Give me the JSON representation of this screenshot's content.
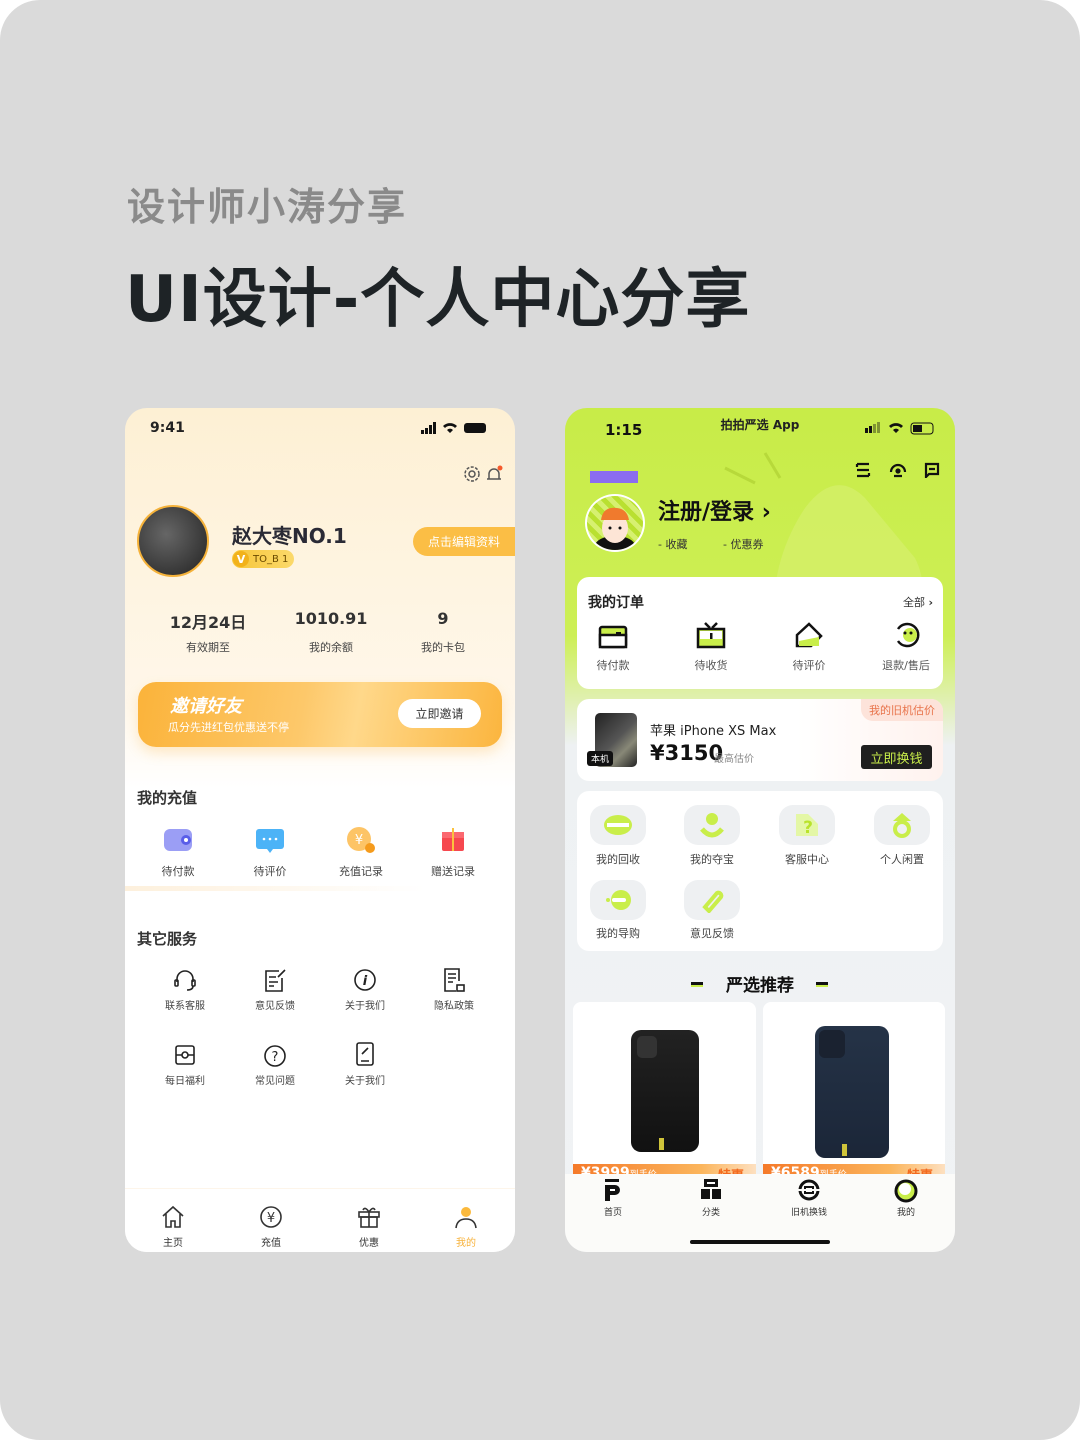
{
  "header": {
    "subtitle": "设计师小涛分享",
    "title": "UI设计-个人中心分享"
  },
  "colors": {
    "orange": "#fbb93c",
    "green": "#c9ee4a",
    "purple": "#8b6cf0",
    "dark": "#1f1f1f"
  },
  "left_phone": {
    "status_time": "9:41",
    "username": "赵大枣NO.1",
    "badge": {
      "icon": "V",
      "label": "TO_B 1"
    },
    "edit_button": "点击编辑资料",
    "stats": [
      {
        "value": "12月24日",
        "label": "有效期至"
      },
      {
        "value": "1010.91",
        "label": "我的余额"
      },
      {
        "value": "9",
        "label": "我的卡包"
      }
    ],
    "invite": {
      "title": "邀请好友",
      "subtitle": "瓜分先进红包优惠送不停",
      "button": "立即邀请"
    },
    "recharge": {
      "title": "我的充值",
      "items": [
        {
          "label": "待付款",
          "icon": "wallet-icon"
        },
        {
          "label": "待评价",
          "icon": "chat-icon"
        },
        {
          "label": "充值记录",
          "icon": "yuan-coin-icon"
        },
        {
          "label": "赠送记录",
          "icon": "gift-icon"
        }
      ]
    },
    "services": {
      "title": "其它服务",
      "items": [
        {
          "label": "联系客服",
          "icon": "headset-icon"
        },
        {
          "label": "意见反馈",
          "icon": "feedback-icon"
        },
        {
          "label": "关于我们",
          "icon": "info-icon"
        },
        {
          "label": "隐私政策",
          "icon": "privacy-icon"
        },
        {
          "label": "每日福利",
          "icon": "welfare-icon"
        },
        {
          "label": "常见问题",
          "icon": "question-icon"
        },
        {
          "label": "关于我们",
          "icon": "phone-link-icon"
        }
      ]
    },
    "tabs": [
      {
        "label": "主页",
        "icon": "home-icon"
      },
      {
        "label": "充值",
        "icon": "recharge-icon"
      },
      {
        "label": "优惠",
        "icon": "gift-icon"
      },
      {
        "label": "我的",
        "icon": "user-icon",
        "active": true
      }
    ]
  },
  "right_phone": {
    "status_time": "1:15",
    "app_title": "拍拍严选 App",
    "login": "注册/登录 ›",
    "favorites": "- 收藏",
    "coupons": "- 优惠券",
    "orders": {
      "title": "我的订单",
      "all": "全部",
      "items": [
        {
          "label": "待付款",
          "icon": "wallet-icon"
        },
        {
          "label": "待收货",
          "icon": "tv-box-icon"
        },
        {
          "label": "待评价",
          "icon": "tag-icon"
        },
        {
          "label": "退款/售后",
          "icon": "refund-icon"
        }
      ]
    },
    "trade_in": {
      "tag": "我的旧机估价",
      "device_tag": "本机",
      "model": "苹果 iPhone XS Max",
      "price": "¥3150",
      "price_note": "最高估价",
      "button": "立即换钱"
    },
    "services": [
      {
        "label": "我的回收",
        "icon": "recycle-icon"
      },
      {
        "label": "我的夺宝",
        "icon": "treasure-icon"
      },
      {
        "label": "客服中心",
        "icon": "help-icon"
      },
      {
        "label": "个人闲置",
        "icon": "idle-icon"
      },
      {
        "label": "我的导购",
        "icon": "guide-icon"
      },
      {
        "label": "意见反馈",
        "icon": "pen-icon"
      }
    ],
    "recommend_title": "严选推荐",
    "products": [
      {
        "price": "¥3999",
        "price_note": "到手价",
        "tag": "特惠"
      },
      {
        "price": "¥6589",
        "price_note": "到手价",
        "tag": "特惠"
      }
    ],
    "tabs": [
      {
        "label": "首页",
        "icon": "home-p-icon"
      },
      {
        "label": "分类",
        "icon": "category-icon"
      },
      {
        "label": "旧机换钱",
        "icon": "trade-icon"
      },
      {
        "label": "我的",
        "icon": "me-icon",
        "active": true
      }
    ]
  }
}
